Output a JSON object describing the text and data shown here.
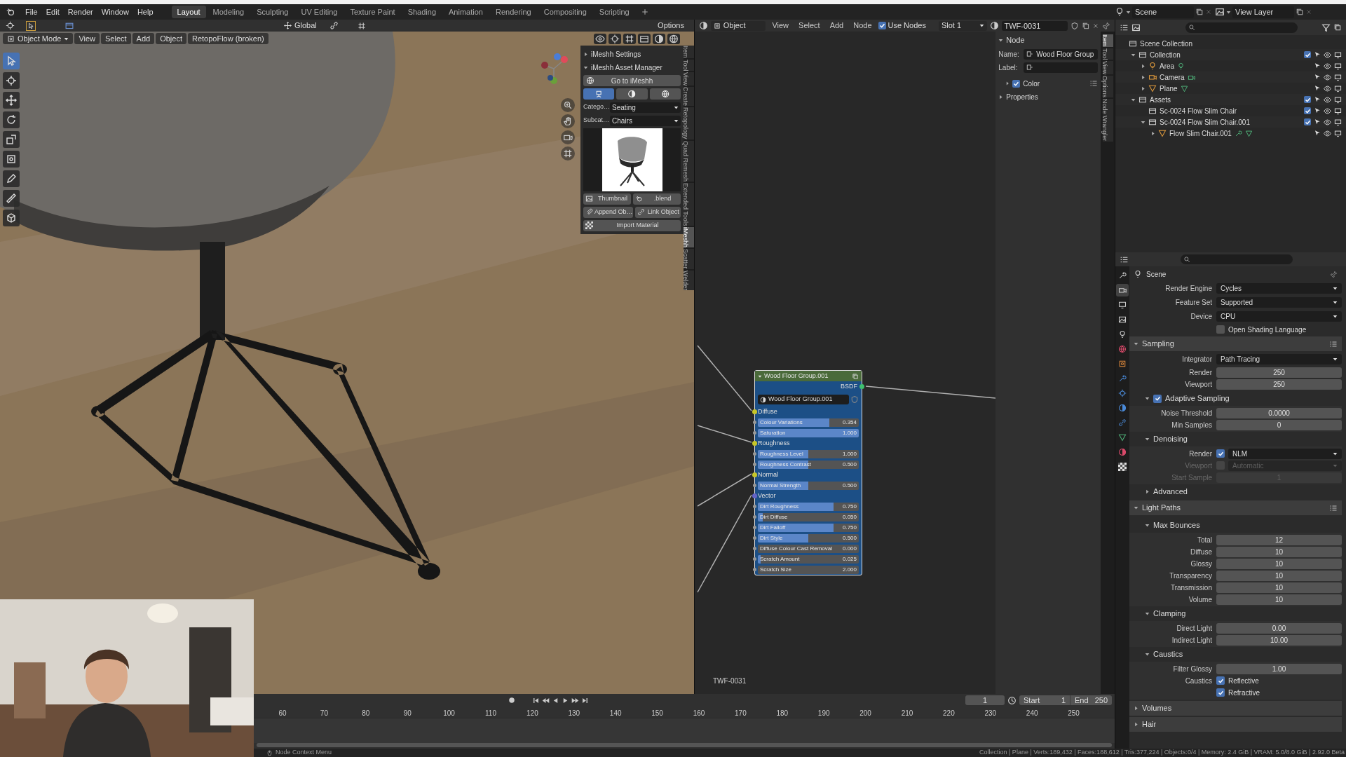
{
  "menu": [
    "File",
    "Edit",
    "Render",
    "Window",
    "Help"
  ],
  "workspaces": [
    {
      "label": "Layout",
      "selected": true
    },
    {
      "label": "Modeling",
      "selected": false
    },
    {
      "label": "Sculpting",
      "selected": false
    },
    {
      "label": "UV Editing",
      "selected": false
    },
    {
      "label": "Texture Paint",
      "selected": false
    },
    {
      "label": "Shading",
      "selected": false
    },
    {
      "label": "Animation",
      "selected": false
    },
    {
      "label": "Rendering",
      "selected": false
    },
    {
      "label": "Compositing",
      "selected": false
    },
    {
      "label": "Scripting",
      "selected": false
    }
  ],
  "scene": "Scene",
  "view_layer": "View Layer",
  "viewport": {
    "transform": "Global",
    "options": "Options",
    "mode": "Object Mode",
    "menus": [
      "View",
      "Select",
      "Add",
      "Object",
      "RetopoFlow (broken)"
    ],
    "tools": [
      {
        "kind": "cursor",
        "selected": true
      },
      {
        "kind": "cursor2",
        "selected": false
      },
      {
        "kind": "move",
        "selected": false
      },
      {
        "kind": "rotate",
        "selected": false
      },
      {
        "kind": "scale",
        "selected": false
      },
      {
        "kind": "transform",
        "selected": false
      },
      {
        "kind": "annotate",
        "selected": false
      },
      {
        "kind": "measure",
        "selected": false
      },
      {
        "kind": "cube",
        "selected": false
      }
    ],
    "panels": [
      {
        "title": "iMeshh Settings",
        "expanded": false
      },
      {
        "title": "iMeshh Asset Manager",
        "expanded": true
      }
    ],
    "go_button": "Go to iMeshh",
    "type_buttons": [
      {
        "kind": "model",
        "selected": true
      },
      {
        "kind": "material",
        "selected": false
      },
      {
        "kind": "world",
        "selected": false
      }
    ],
    "fields": [
      {
        "label": "Catego…",
        "value": "Seating"
      },
      {
        "label": "Subcat…",
        "value": "Chairs"
      }
    ],
    "buttons": [
      {
        "kind": "thumbnail",
        "label": "Thumbnail"
      },
      {
        "kind": "blend",
        "label": ".blend"
      },
      {
        "kind": "append",
        "label": "Append Ob…"
      },
      {
        "kind": "link",
        "label": "Link Object"
      },
      {
        "kind": "material",
        "label": "Import Material"
      }
    ],
    "tabs": [
      {
        "label": "Item",
        "selected": false
      },
      {
        "label": "Tool",
        "selected": false
      },
      {
        "label": "View",
        "selected": false
      },
      {
        "label": "Create",
        "selected": false
      },
      {
        "label": "Retopology",
        "selected": false
      },
      {
        "label": "Quad Remesh",
        "selected": false
      },
      {
        "label": "Extended Tools",
        "selected": false
      },
      {
        "label": "iMeshh",
        "selected": true
      },
      {
        "label": "Scatter",
        "selected": false
      },
      {
        "label": "Welder",
        "selected": false
      }
    ]
  },
  "node_editor": {
    "object": "Object",
    "menus": [
      "View",
      "Select",
      "Add",
      "Node"
    ],
    "use_nodes": {
      "label": "Use Nodes",
      "checked": true
    },
    "slot": "Slot 1",
    "material": "TWF-0031",
    "material_label": "TWF-0031",
    "node": {
      "title": "Wood Floor Group.001",
      "output": "BSDF",
      "group": "Wood Floor Group.001",
      "items": [
        {
          "kind": "socket",
          "label": "Diffuse",
          "color": "#c7c729"
        },
        {
          "kind": "slider",
          "label": "Colour Variations",
          "value": "0.354",
          "level": 0.71
        },
        {
          "kind": "slider",
          "label": "Saturation",
          "value": "1.000",
          "level": 1
        },
        {
          "kind": "socket",
          "label": "Roughness",
          "color": "#c7c729"
        },
        {
          "kind": "slider",
          "label": "Roughness Level",
          "value": "1.000",
          "level": 0.5
        },
        {
          "kind": "slider",
          "label": "Roughness Contrast",
          "value": "0.500",
          "level": 0.5
        },
        {
          "kind": "socket",
          "label": "Normal",
          "color": "#c7c729"
        },
        {
          "kind": "slider",
          "label": "Normal Strength",
          "value": "0.500",
          "level": 0.5
        },
        {
          "kind": "socket",
          "label": "Vector",
          "color": "#6363c7"
        },
        {
          "kind": "slider",
          "label": "Dirt Roughness",
          "value": "0.750",
          "level": 0.75
        },
        {
          "kind": "slider",
          "label": "Dirt Diffuse",
          "value": "0.050",
          "level": 0.05
        },
        {
          "kind": "slider",
          "label": "Dirt Falloff",
          "value": "0.750",
          "level": 0.75
        },
        {
          "kind": "slider",
          "label": "Dirt Style",
          "value": "0.500",
          "level": 0.5
        },
        {
          "kind": "slider",
          "label": "Diffuse Colour Cast Removal",
          "value": "0.000",
          "level": 0
        },
        {
          "kind": "slider",
          "label": "Scratch Amount",
          "value": "0.025",
          "level": 0.025
        },
        {
          "kind": "slider",
          "label": "Scratch Size",
          "value": "2.000",
          "level": 0
        }
      ]
    },
    "sidebar": {
      "panel": "Node",
      "name_label": "Name:",
      "name": "Wood Floor Group",
      "label_label": "Label:",
      "color": {
        "label": "Color",
        "checked": true
      },
      "properties": "Properties",
      "tabs": [
        {
          "label": "Item",
          "selected": true
        },
        {
          "label": "Tool",
          "selected": false
        },
        {
          "label": "View",
          "selected": false
        },
        {
          "label": "Options",
          "selected": false
        },
        {
          "label": "Node Wrangler",
          "selected": false
        }
      ]
    }
  },
  "outliner": [
    {
      "name": "Scene Collection",
      "kind": "scene",
      "children": [
        {
          "name": "Collection",
          "kind": "collection",
          "expanded": true,
          "checked": true,
          "children": [
            {
              "name": "Area",
              "kind": "light",
              "expanded": false
            },
            {
              "name": "Camera",
              "kind": "camera",
              "expanded": false
            },
            {
              "name": "Plane",
              "kind": "mesh",
              "expanded": false
            }
          ]
        },
        {
          "name": "Assets",
          "kind": "collection",
          "expanded": true,
          "checked": true,
          "children": [
            {
              "name": "Sc-0024 Flow Slim Chair",
              "kind": "collection",
              "checked": true
            },
            {
              "name": "Sc-0024 Flow Slim Chair.001",
              "kind": "collection",
              "expanded": true,
              "checked": true,
              "children": [
                {
                  "name": "Flow Slim Chair.001",
                  "kind": "mesh_mod",
                  "expanded": false
                }
              ]
            }
          ]
        }
      ]
    }
  ],
  "properties": {
    "tabs": [
      {
        "kind": "tool",
        "selected": false
      },
      {
        "kind": "render",
        "selected": true
      },
      {
        "kind": "output",
        "selected": false
      },
      {
        "kind": "view_layer",
        "selected": false
      },
      {
        "kind": "scene",
        "selected": false
      },
      {
        "kind": "world",
        "selected": false
      },
      {
        "kind": "object",
        "selected": false
      },
      {
        "kind": "modifier",
        "selected": false
      },
      {
        "kind": "particles",
        "selected": false
      },
      {
        "kind": "physics",
        "selected": false
      },
      {
        "kind": "constraints",
        "selected": false
      },
      {
        "kind": "data",
        "selected": false
      },
      {
        "kind": "material",
        "selected": false
      },
      {
        "kind": "texture",
        "selected": false
      }
    ],
    "title": "Scene",
    "rows": [
      {
        "kind": "dropdown",
        "label": "Render Engine",
        "value": "Cycles"
      },
      {
        "kind": "dropdown",
        "label": "Feature Set",
        "value": "Supported"
      },
      {
        "kind": "dropdown",
        "label": "Device",
        "value": "CPU"
      },
      {
        "kind": "check",
        "text": "Open Shading Language",
        "checked": false
      }
    ],
    "panels": [
      {
        "title": "Sampling",
        "expanded": true,
        "rows": [
          {
            "kind": "dropdown",
            "label": "Integrator",
            "value": "Path Tracing"
          },
          {
            "kind": "number",
            "label": "Render",
            "value": "250"
          },
          {
            "kind": "number",
            "label": "Viewport",
            "value": "250"
          }
        ],
        "children": [
          {
            "title": "Adaptive Sampling",
            "expanded": true,
            "checked": true,
            "rows": [
              {
                "kind": "number",
                "label": "Noise Threshold",
                "value": "0.0000"
              },
              {
                "kind": "number",
                "label": "Min Samples",
                "value": "0"
              }
            ]
          },
          {
            "title": "Denoising",
            "expanded": true,
            "rows": [
              {
                "kind": "check_dropdown",
                "label": "Render",
                "checked": true,
                "value": "NLM",
                "disabled": false
              },
              {
                "kind": "check_dropdown",
                "label": "Viewport",
                "checked": false,
                "value": "Automatic",
                "disabled": true
              },
              {
                "kind": "number",
                "label": "Start Sample",
                "value": "1",
                "disabled": true
              }
            ]
          },
          {
            "title": "Advanced",
            "expanded": false
          }
        ]
      },
      {
        "title": "Light Paths",
        "expanded": true,
        "children": [
          {
            "title": "Max Bounces",
            "expanded": true,
            "rows": [
              {
                "kind": "number",
                "label": "Total",
                "value": "12"
              },
              {
                "kind": "number",
                "label": "Diffuse",
                "value": "10"
              },
              {
                "kind": "number",
                "label": "Glossy",
                "value": "10"
              },
              {
                "kind": "number",
                "label": "Transparency",
                "value": "10"
              },
              {
                "kind": "number",
                "label": "Transmission",
                "value": "10"
              },
              {
                "kind": "number",
                "label": "Volume",
                "value": "10"
              }
            ]
          },
          {
            "title": "Clamping",
            "expanded": true,
            "rows": [
              {
                "kind": "number",
                "label": "Direct Light",
                "value": "0.00"
              },
              {
                "kind": "number",
                "label": "Indirect Light",
                "value": "10.00"
              }
            ]
          },
          {
            "title": "Caustics",
            "expanded": true,
            "rows": [
              {
                "kind": "number",
                "label": "Filter Glossy",
                "value": "1.00"
              },
              {
                "kind": "check",
                "label": "Caustics",
                "text": "Reflective",
                "checked": true
              },
              {
                "kind": "check",
                "text": "Refractive",
                "checked": true
              }
            ]
          }
        ]
      },
      {
        "title": "Volumes",
        "expanded": false
      },
      {
        "title": "Hair",
        "expanded": false
      }
    ]
  },
  "timeline": {
    "frame": "1",
    "start_label": "Start",
    "start": "1",
    "end_label": "End",
    "end": "250",
    "ticks": [
      "60",
      "70",
      "80",
      "90",
      "100",
      "110",
      "120",
      "130",
      "140",
      "150",
      "160",
      "170",
      "180",
      "190",
      "200",
      "210",
      "220",
      "230",
      "240",
      "250"
    ]
  },
  "status": {
    "hint": "Node Context Menu",
    "stats": "Collection | Plane | Verts:189,432 | Faces:188,612 | Tris:377,224 | Objects:0/4 | Memory: 2.4 GiB | VRAM: 5.0/8.0 GiB | 2.92.0 Beta"
  }
}
